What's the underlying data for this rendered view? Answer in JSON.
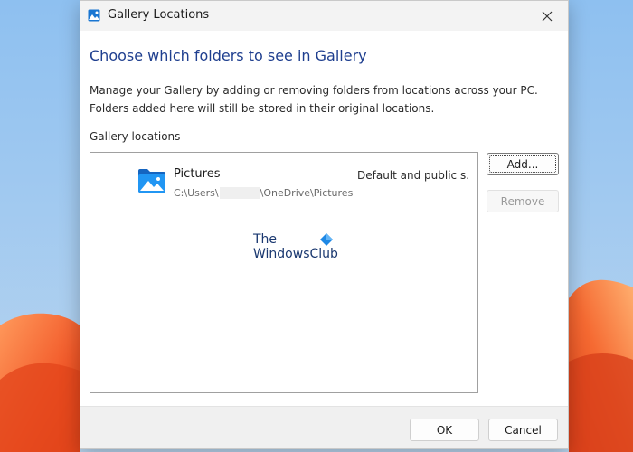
{
  "window": {
    "title": "Gallery Locations",
    "icon": "gallery-app-icon",
    "close_icon": "close-icon"
  },
  "content": {
    "heading": "Choose which folders to see in Gallery",
    "description": "Manage your Gallery by adding or removing folders from locations across your PC. Folders added here will still be stored in their original locations.",
    "section_label": "Gallery locations"
  },
  "locations": [
    {
      "name": "Pictures",
      "path_prefix": "C:\\Users\\",
      "path_suffix": "\\OneDrive\\Pictures",
      "type": "Default and public s...",
      "icon": "pictures-folder-icon"
    }
  ],
  "watermark": {
    "line1": "The",
    "line2": "WindowsClub"
  },
  "buttons": {
    "add": "Add...",
    "remove": "Remove",
    "ok": "OK",
    "cancel": "Cancel"
  },
  "colors": {
    "heading": "#1f3f8f",
    "folder_icon": "#1e88e5",
    "wallpaper_sky": "#9fc6ec",
    "wallpaper_accent": "#f25a2a"
  }
}
